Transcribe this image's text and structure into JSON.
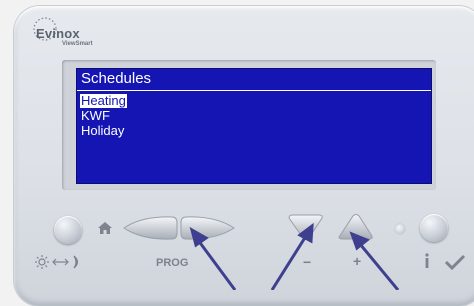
{
  "brand": {
    "name": "Evinox",
    "product": "ViewSmart"
  },
  "screen": {
    "title": "Schedules",
    "items": [
      {
        "label": "Heating",
        "selected": true
      },
      {
        "label": "KWF",
        "selected": false
      },
      {
        "label": "Holiday",
        "selected": false
      }
    ]
  },
  "labels": {
    "prog": "PROG",
    "minus": "−",
    "plus": "+"
  },
  "colors": {
    "screen_bg": "#1515b4",
    "screen_text": "#ffffff",
    "arrow": "#3f3f8f"
  }
}
